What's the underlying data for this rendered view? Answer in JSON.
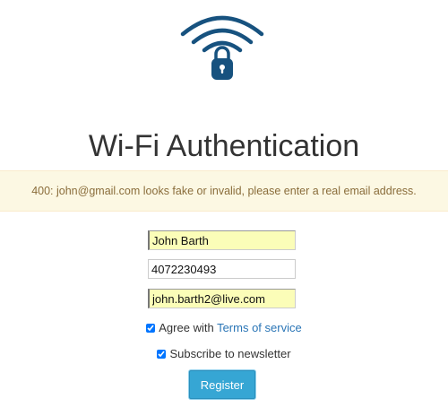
{
  "logo": {
    "icon": "wifi-lock-icon",
    "color": "#17527f"
  },
  "page": {
    "title": "Wi-Fi Authentication"
  },
  "alert": {
    "text": "400: john@gmail.com looks fake or invalid, please enter a real email address."
  },
  "form": {
    "name_value": "John Barth",
    "phone_value": "4072230493",
    "email_value": "john.barth2@live.com",
    "agree_prefix": "Agree with",
    "agree_link": "Terms of service",
    "agree_checked": true,
    "newsletter_label": "Subscribe to newsletter",
    "newsletter_checked": true,
    "submit_label": "Register"
  },
  "colors": {
    "alert_bg": "#fcf8e3",
    "alert_text": "#8a6d3b",
    "link": "#2a75b6",
    "button": "#36a6d4",
    "autofill_bg": "#fbfdb8"
  }
}
